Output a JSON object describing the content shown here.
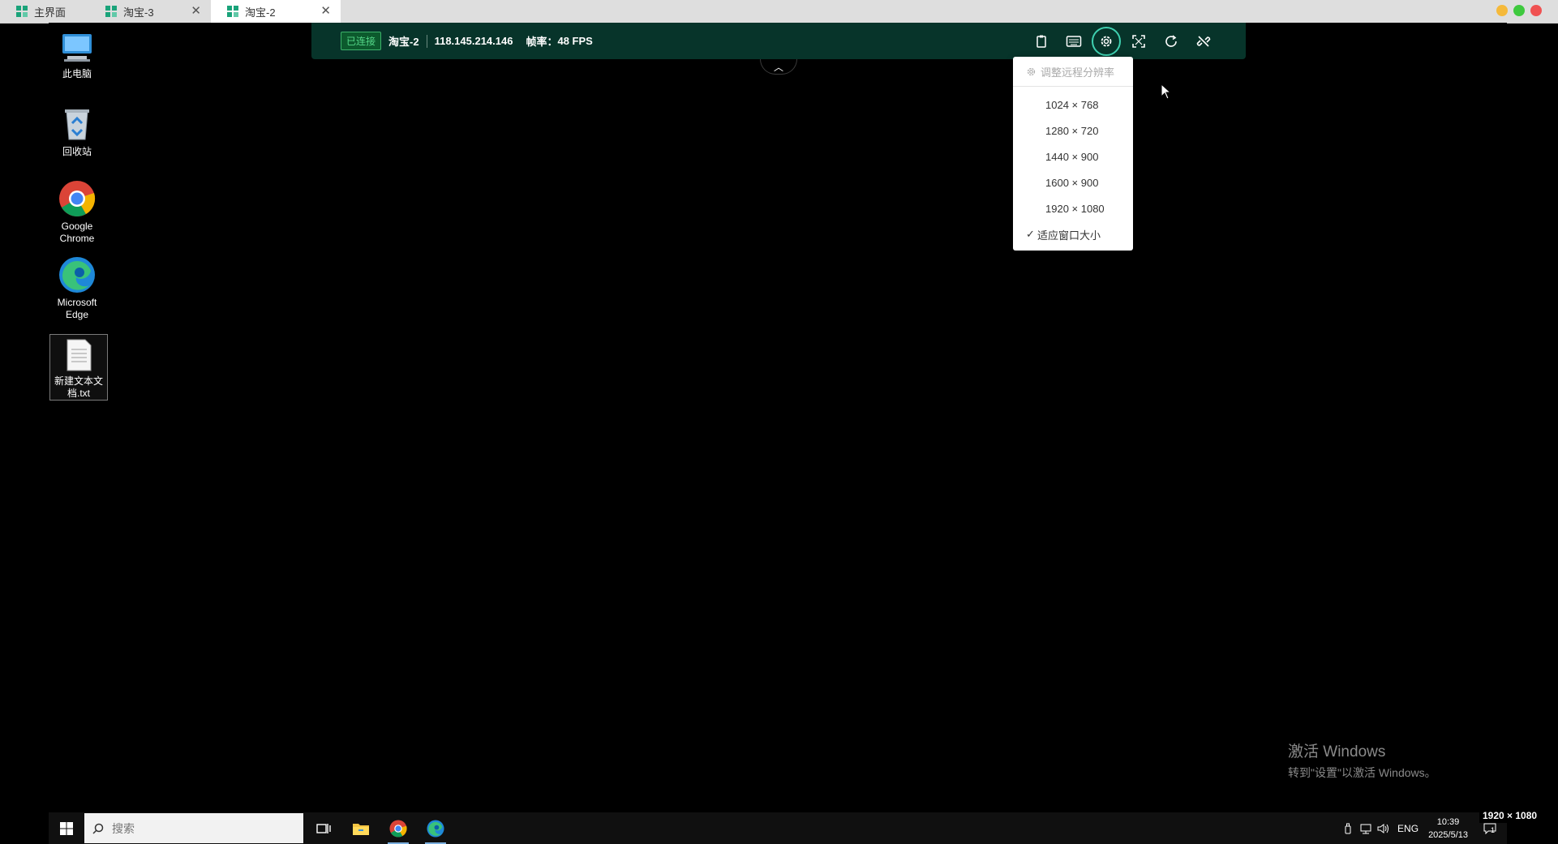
{
  "tabs": [
    {
      "label": "主界面",
      "closable": false,
      "active": false
    },
    {
      "label": "淘宝-3",
      "closable": true,
      "active": false
    },
    {
      "label": "淘宝-2",
      "closable": true,
      "active": true
    }
  ],
  "window_controls": {
    "colors": [
      "#f5b93a",
      "#3ec93e",
      "#f05252"
    ]
  },
  "desktop_icons": [
    {
      "label": "此电脑",
      "icon": "computer-icon"
    },
    {
      "label": "回收站",
      "icon": "recycle-bin-icon"
    },
    {
      "label": "Google Chrome",
      "icon": "chrome-icon"
    },
    {
      "label": "Microsoft Edge",
      "icon": "edge-icon"
    },
    {
      "label": "新建文本文档.txt",
      "icon": "text-file-icon"
    }
  ],
  "toolbar": {
    "status": "已连接",
    "session_name": "淘宝-2",
    "ip": "118.145.214.146",
    "fps_label": "帧率：",
    "fps_value": "48 FPS",
    "buttons": [
      "clipboard-icon",
      "keyboard-icon",
      "gear-icon",
      "fullscreen-icon",
      "refresh-icon",
      "disconnect-icon"
    ],
    "accent": "#3fd0b0",
    "background": "#07342a"
  },
  "resolution_menu": {
    "header": "调整远程分辨率",
    "options": [
      "1024 × 768",
      "1280 × 720",
      "1440 × 900",
      "1600 × 900",
      "1920 × 1080"
    ],
    "fit_window": "适应窗口大小",
    "selected": "适应窗口大小"
  },
  "watermark": {
    "title": "激活 Windows",
    "subtitle": "转到\"设置\"以激活 Windows。"
  },
  "taskbar": {
    "search_placeholder": "搜索",
    "apps": [
      "task-view-icon",
      "file-explorer-icon",
      "chrome-icon",
      "edge-icon"
    ],
    "lang": "ENG",
    "time": "10:39",
    "date": "2025/5/13",
    "notification_count": "1"
  },
  "resolution_badge": "1920 × 1080"
}
